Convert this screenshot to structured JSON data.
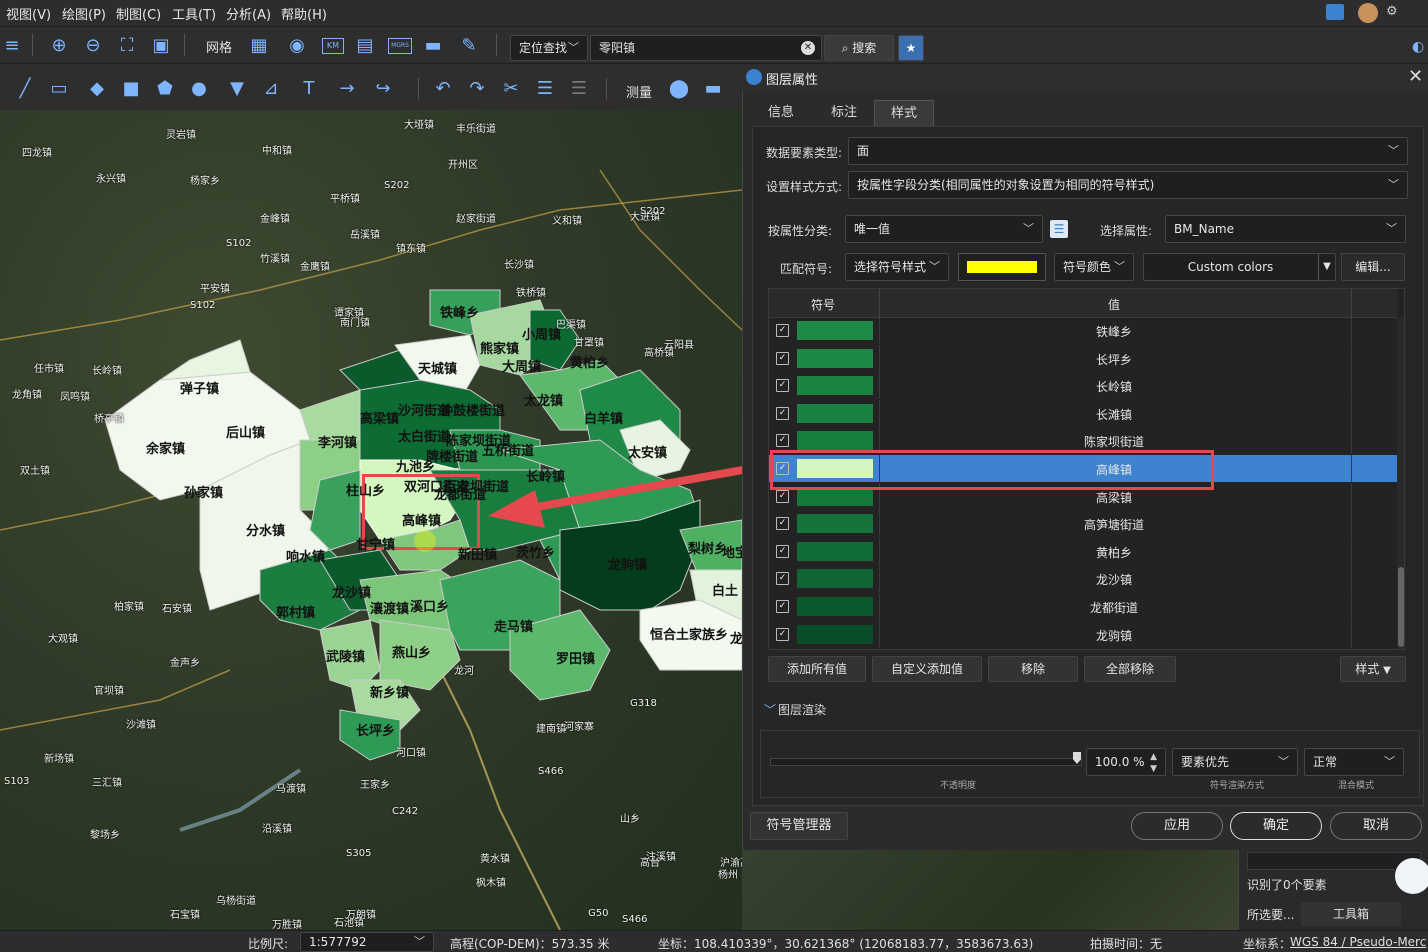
{
  "menu": [
    "视图(V)",
    "绘图(P)",
    "制图(C)",
    "工具(T)",
    "分析(A)",
    "帮助(H)"
  ],
  "toolbar": {
    "grid_label": "网格",
    "locate_mode": "定位查找",
    "search_value": "零阳镇",
    "search_button": "搜索",
    "measure_label": "测量",
    "icon_badges": [
      "KM",
      "MGRS"
    ]
  },
  "map": {
    "towns": [
      "弹子镇",
      "后山镇",
      "余家镇",
      "孙家镇",
      "分水镇",
      "响水镇",
      "天城镇",
      "熊家镇",
      "小周镇",
      "大周镇",
      "黄柏乡",
      "铁峰乡",
      "高梁镇",
      "沙河街道",
      "钟鼓楼街道",
      "太龙镇",
      "白羊镇",
      "李河镇",
      "太白街道",
      "陈家坝街道",
      "牌楼街道",
      "五桥街道",
      "太安镇",
      "九池乡",
      "双河口街道",
      "百安坝街道",
      "龙都街道",
      "长岭镇",
      "柱山乡",
      "高峰镇",
      "甘宁镇",
      "新田镇",
      "茨竹乡",
      "龙驹镇",
      "梨树乡",
      "地宝",
      "白土",
      "龙沙镇",
      "郭村镇",
      "瀼渡镇",
      "溪口乡",
      "走马镇",
      "恒合土家族乡",
      "武陵镇",
      "燕山乡",
      "罗田镇",
      "新乡镇",
      "长坪乡",
      "龙"
    ],
    "places": [
      "灵岩镇",
      "四龙镇",
      "永兴镇",
      "中和镇",
      "杨家乡",
      "大垭镇",
      "丰乐街道",
      "开州区",
      "S202",
      "S102",
      "平桥镇",
      "金峰镇",
      "赵家街道",
      "大进镇",
      "镇东镇",
      "S202",
      "岳溪镇",
      "金鹰镇",
      "义和镇",
      "竹溪镇",
      "长沙镇",
      "平安镇",
      "铁桥镇",
      "谭家镇",
      "S102",
      "巴渠镇",
      "甘罩镇",
      "高桥镇",
      "南门镇",
      "云阳县",
      "任市镇",
      "长岭镇",
      "龙角镇",
      "凤鸣镇",
      "桥亭镇",
      "双土镇",
      "柏家镇",
      "石安镇",
      "大观镇",
      "金声乡",
      "官坝镇",
      "沙滩镇",
      "新场镇",
      "S103",
      "三汇镇",
      "马渡镇",
      "黎场乡",
      "沿溪镇",
      "万胜镇",
      "乌杨街道",
      "石宝镇",
      "王家乡",
      "S466",
      "G318",
      "建南镇",
      "黄水镇",
      "G50",
      "注溪镇",
      "枫木镇",
      "龙河",
      "石池镇",
      "万朗镇",
      "S305",
      "河家寨",
      "河口镇",
      "C242",
      "沪渝高速",
      "高台",
      "S466",
      "山乡",
      "杨州"
    ]
  },
  "dialog": {
    "title": "图层属性",
    "tabs": [
      "信息",
      "标注",
      "样式"
    ],
    "active_tab": "样式",
    "data_type_label": "数据要素类型:",
    "data_type_value": "面",
    "style_mode_label": "设置样式方式:",
    "style_mode_value": "按属性字段分类(相同属性的对象设置为相同的符号样式)",
    "classify_label": "按属性分类:",
    "classify_value": "唯一值",
    "select_attr_label": "选择属性:",
    "select_attr_value": "BM_Name",
    "match_symbol_label": "匹配符号:",
    "symbol_style_value": "选择符号样式",
    "symbol_color_value": "符号颜色",
    "palette_value": "Custom colors",
    "edit_button": "编辑...",
    "color_preview": "#ffff00",
    "table": {
      "headers": [
        "符号",
        "值"
      ],
      "rows": [
        {
          "value": "铁峰乡",
          "color": "#1f8a47",
          "checked": true,
          "selected": false
        },
        {
          "value": "长坪乡",
          "color": "#1d8745",
          "checked": true,
          "selected": false
        },
        {
          "value": "长岭镇",
          "color": "#1b8443",
          "checked": true,
          "selected": false
        },
        {
          "value": "长滩镇",
          "color": "#198141",
          "checked": true,
          "selected": false
        },
        {
          "value": "陈家坝街道",
          "color": "#177e3f",
          "checked": true,
          "selected": false
        },
        {
          "value": "高峰镇",
          "color": "#d4f7c0",
          "checked": true,
          "selected": true
        },
        {
          "value": "高梁镇",
          "color": "#15793c",
          "checked": true,
          "selected": false
        },
        {
          "value": "高笋塘街道",
          "color": "#13733a",
          "checked": true,
          "selected": false
        },
        {
          "value": "黄柏乡",
          "color": "#116d37",
          "checked": true,
          "selected": false
        },
        {
          "value": "龙沙镇",
          "color": "#0f6634",
          "checked": true,
          "selected": false
        },
        {
          "value": "龙都街道",
          "color": "#0b5a2e",
          "checked": true,
          "selected": false
        },
        {
          "value": "龙驹镇",
          "color": "#084d28",
          "checked": true,
          "selected": false
        }
      ]
    },
    "add_all_button": "添加所有值",
    "custom_add_button": "自定义添加值",
    "remove_button": "移除",
    "remove_all_button": "全部移除",
    "style_button": "样式",
    "render_section": "图层渲染",
    "opacity_value": "100.0 %",
    "opacity_label": "不透明度",
    "render_mode_value": "要素优先",
    "render_mode_label": "符号渲染方式",
    "blend_value": "正常",
    "blend_label": "混合模式",
    "symbol_manager_button": "符号管理器",
    "apply_button": "应用",
    "ok_button": "确定",
    "cancel_button": "取消"
  },
  "side_panel": {
    "identify_text": "识别了0个要素",
    "selection_tab": "所选要...",
    "toolbox_tab": "工具箱"
  },
  "status": {
    "scale_label": "比例尺:",
    "scale_value": "1:577792",
    "elevation": "高程(COP-DEM)：573.35 米",
    "coords": "坐标：108.410339°，30.621368°  (12068183.77，3583673.63)",
    "capture_time": "拍摄时间：无",
    "crs_label": "坐标系：",
    "crs_value": "WGS 84 / Pseudo-Merc"
  },
  "colors": {
    "accent": "#3b82d0",
    "highlight": "#e5484d",
    "selection_row": "#3d83d0"
  }
}
